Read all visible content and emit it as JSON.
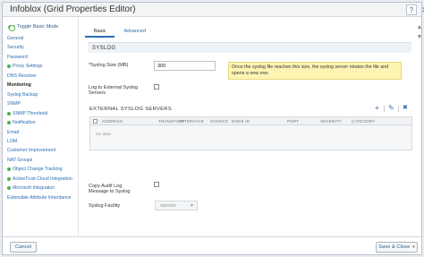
{
  "window": {
    "title": "Infoblox (Grid Properties Editor)",
    "help_label": "?",
    "close_label": "✕"
  },
  "sidebar": {
    "toggle_label": "Toggle Basic Mode",
    "items": [
      {
        "label": "General",
        "dot": false,
        "active": false
      },
      {
        "label": "Security",
        "dot": false,
        "active": false
      },
      {
        "label": "Password",
        "dot": false,
        "active": false
      },
      {
        "label": "Proxy Settings",
        "dot": true,
        "active": false
      },
      {
        "label": "DNS Resolver",
        "dot": false,
        "active": false
      },
      {
        "label": "Monitoring",
        "dot": false,
        "active": true
      },
      {
        "label": "Syslog Backup",
        "dot": false,
        "active": false
      },
      {
        "label": "SNMP",
        "dot": false,
        "active": false
      },
      {
        "label": "SNMP Threshold",
        "dot": true,
        "active": false
      },
      {
        "label": "Notification",
        "dot": true,
        "active": false
      },
      {
        "label": "Email",
        "dot": false,
        "active": false
      },
      {
        "label": "LOM",
        "dot": false,
        "active": false
      },
      {
        "label": "Customer Improvement",
        "dot": false,
        "active": false
      },
      {
        "label": "NAT Groups",
        "dot": false,
        "active": false
      },
      {
        "label": "Object Change Tracking",
        "dot": true,
        "active": false
      },
      {
        "label": "ActiveTrust Cloud Integration",
        "dot": true,
        "active": false
      },
      {
        "label": "Microsoft Integration",
        "dot": true,
        "active": false
      },
      {
        "label": "Extensible Attribute Inheritance",
        "dot": false,
        "active": false
      }
    ]
  },
  "tabs": [
    {
      "label": "Basic",
      "active": true
    },
    {
      "label": "Advanced",
      "active": false
    }
  ],
  "section": {
    "title": "SYSLOG"
  },
  "form": {
    "syslog_size_label": "*Syslog Size (MB)",
    "syslog_size_value": "300",
    "syslog_hint": "Once the syslog file reaches this size, the syslog server rotates the file and opens a new one.",
    "log_external_label_1": "Log to External Syslog",
    "log_external_label_2": "Servers",
    "external_servers_title": "EXTERNAL SYSLOG SERVERS",
    "copy_audit_label_1": "Copy Audit Log",
    "copy_audit_label_2": "Message to Syslog",
    "syslog_facility_label": "Syslog Facility",
    "syslog_facility_value": "daemon"
  },
  "grid": {
    "columns": [
      "ADDRESS",
      "TRANSPORT",
      "INTERFACE",
      "SOURCE",
      "NODE ID",
      "PORT",
      "SEVERITY",
      "CATEGORY"
    ],
    "empty_text": "No data"
  },
  "toolbar_icons": {
    "add": "+",
    "edit": "✎",
    "delete": "✖"
  },
  "footer": {
    "cancel_label": "Cancel",
    "save_label": "Save & Close",
    "save_caret": "▾"
  }
}
